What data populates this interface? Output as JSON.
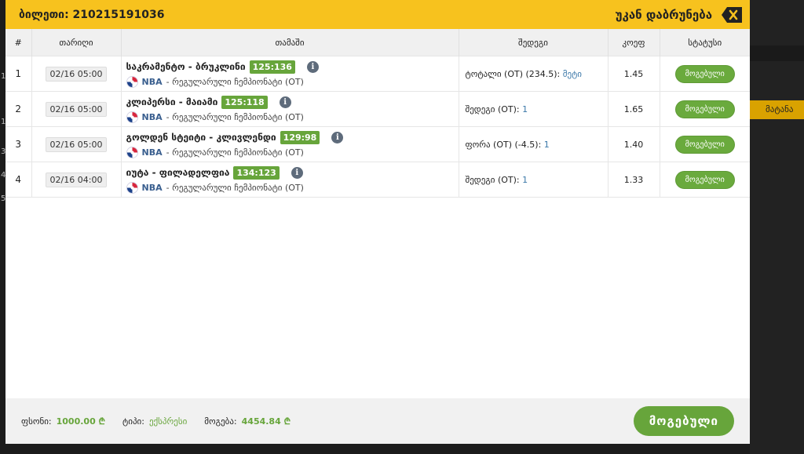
{
  "background": {
    "right_button_label": "მატანა",
    "left_marks": [
      "1",
      "1",
      "3",
      "4",
      "5"
    ]
  },
  "header": {
    "ticket_title": "ბილეთი: 210215191036",
    "back_label": "უკან დაბრუნება",
    "close_icon": "close-tag-icon"
  },
  "table": {
    "columns": [
      "#",
      "თარიღი",
      "თამაში",
      "შედეგი",
      "კოეფ",
      "სტატუსი"
    ],
    "rows": [
      {
        "num": "1",
        "date": "02/16 05:00",
        "match": "საკრამენტო - ბრუკლინი",
        "score": "125:136",
        "league": "NBA",
        "league_desc": "- რეგულარული ჩემპიონატი (OT)",
        "result_label": "ტოტალი (OT) (234.5):",
        "result_value": "მეტი",
        "odds": "1.45",
        "status": "მოგებული"
      },
      {
        "num": "2",
        "date": "02/16 05:00",
        "match": "კლიპერსი - მაიამი",
        "score": "125:118",
        "league": "NBA",
        "league_desc": "- რეგულარული ჩემპიონატი (OT)",
        "result_label": "შედეგი (OT):",
        "result_value": "1",
        "odds": "1.65",
        "status": "მოგებული"
      },
      {
        "num": "3",
        "date": "02/16 05:00",
        "match": "გოლდენ სტეიტი - კლივლენდი",
        "score": "129:98",
        "league": "NBA",
        "league_desc": "- რეგულარული ჩემპიონატი (OT)",
        "result_label": "ფორა (OT) (-4.5):",
        "result_value": "1",
        "odds": "1.40",
        "status": "მოგებული"
      },
      {
        "num": "4",
        "date": "02/16 04:00",
        "match": "იუტა - ფილადელფია",
        "score": "134:123",
        "league": "NBA",
        "league_desc": "- რეგულარული ჩემპიონატი (OT)",
        "result_label": "შედეგი (OT):",
        "result_value": "1",
        "odds": "1.33",
        "status": "მოგებული"
      }
    ]
  },
  "footer": {
    "stake_label": "ფსონი:",
    "stake_value": "1000.00 ₾",
    "type_label": "ტიპი:",
    "type_value": "ექსპრესი",
    "win_label": "მოგება:",
    "win_value": "4454.84 ₾",
    "status_button": "მოგებული"
  },
  "colors": {
    "header_bg": "#f7c21e",
    "win_green": "#67a53b",
    "link_blue": "#3a77a8"
  }
}
